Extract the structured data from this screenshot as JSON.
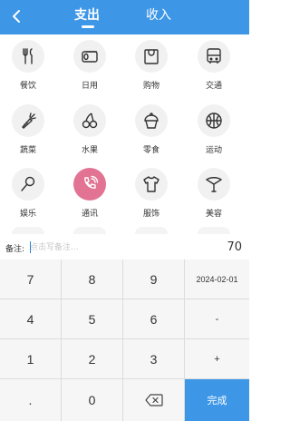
{
  "header": {
    "tab_expense": "支出",
    "tab_income": "收入"
  },
  "categories": [
    {
      "label": "餐饮",
      "icon": "fork-knife-icon"
    },
    {
      "label": "日用",
      "icon": "paper-roll-icon"
    },
    {
      "label": "购物",
      "icon": "shopping-bag-icon"
    },
    {
      "label": "交通",
      "icon": "bus-icon"
    },
    {
      "label": "蔬菜",
      "icon": "carrot-icon"
    },
    {
      "label": "水果",
      "icon": "cherry-icon"
    },
    {
      "label": "零食",
      "icon": "cupcake-icon"
    },
    {
      "label": "运动",
      "icon": "basketball-icon"
    },
    {
      "label": "娱乐",
      "icon": "microphone-icon"
    },
    {
      "label": "通讯",
      "icon": "phone-icon",
      "selected": true
    },
    {
      "label": "服饰",
      "icon": "tshirt-icon"
    },
    {
      "label": "美容",
      "icon": "makeup-icon"
    }
  ],
  "note": {
    "label": "备注:",
    "placeholder": "点击写备注...",
    "amount": "70"
  },
  "keypad": {
    "k7": "7",
    "k8": "8",
    "k9": "9",
    "date": "2024-02-01",
    "k4": "4",
    "k5": "5",
    "k6": "6",
    "minus": "-",
    "k1": "1",
    "k2": "2",
    "k3": "3",
    "plus": "+",
    "dot": ".",
    "k0": "0",
    "done": "完成"
  },
  "colors": {
    "primary": "#3d96e6",
    "selected": "#e27393"
  }
}
